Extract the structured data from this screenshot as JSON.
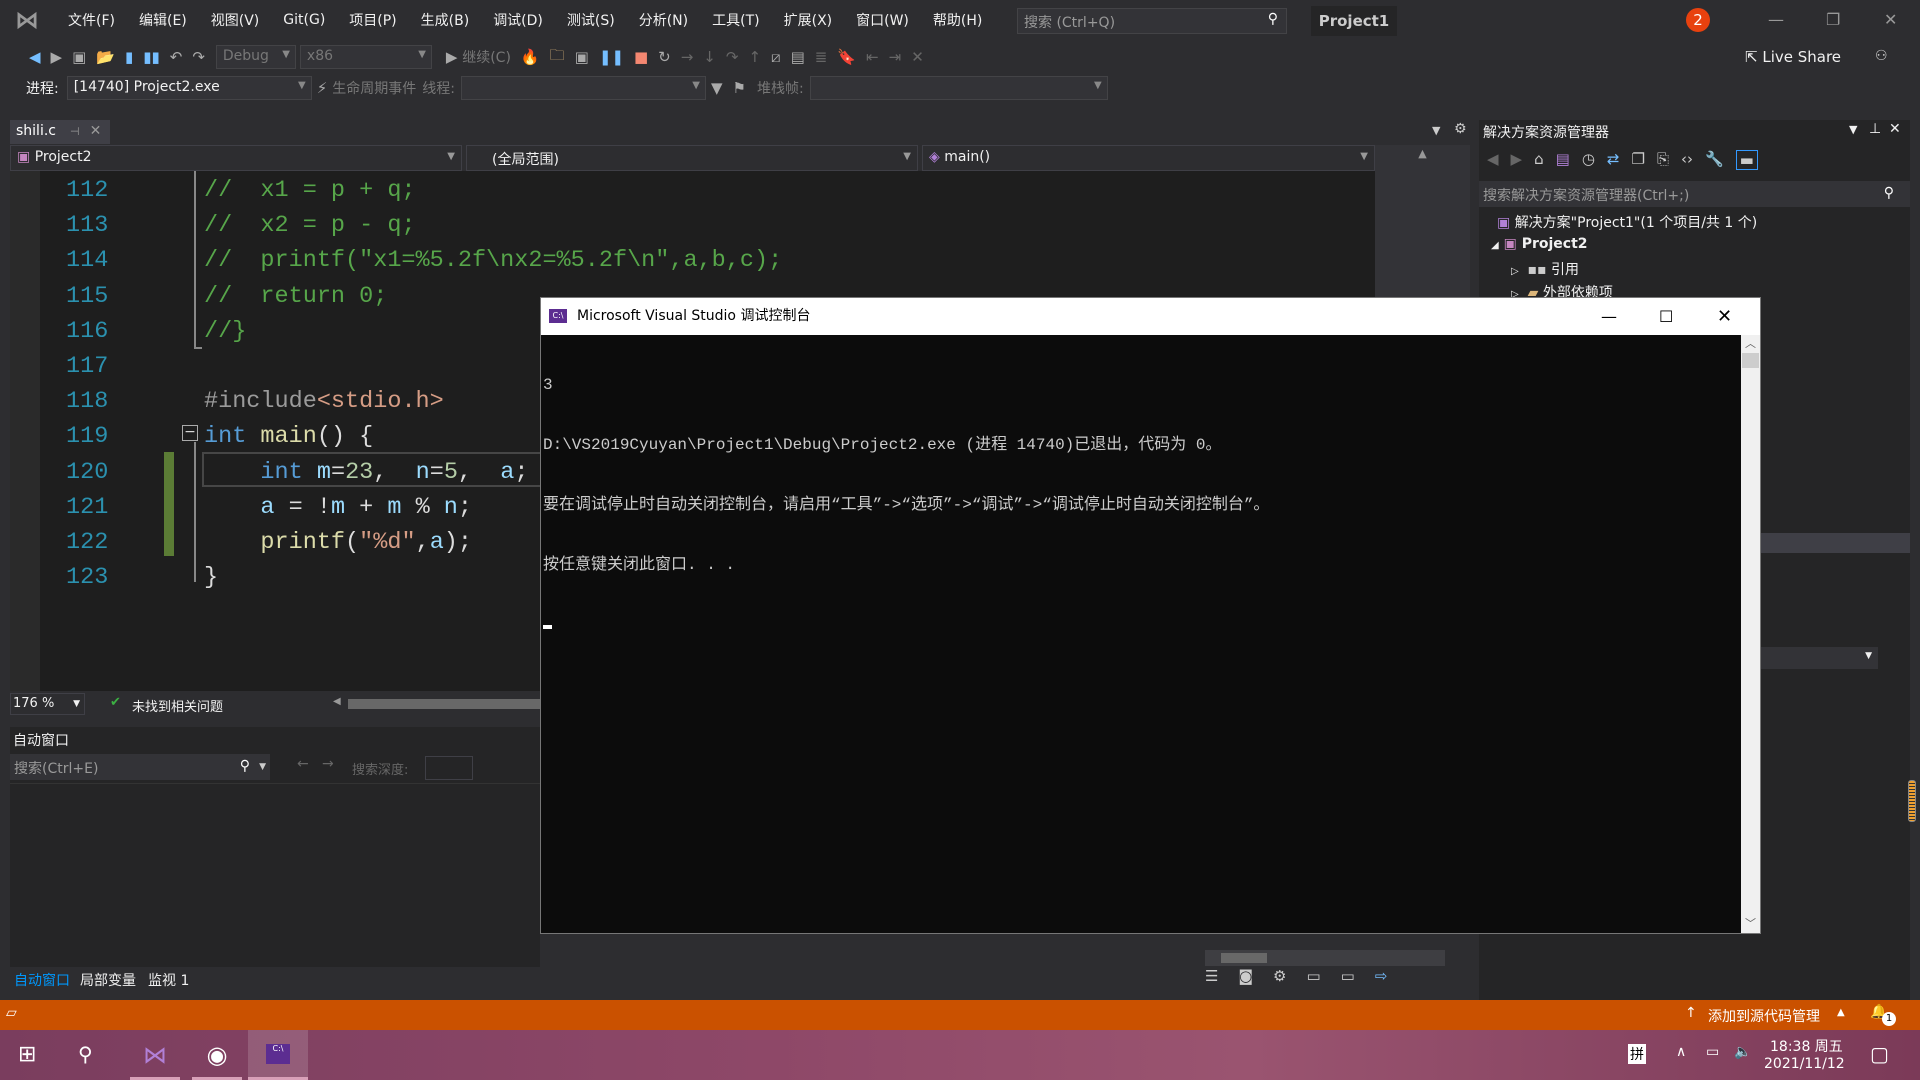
{
  "menubar": {
    "items": [
      "文件(F)",
      "编辑(E)",
      "视图(V)",
      "Git(G)",
      "项目(P)",
      "生成(B)",
      "调试(D)",
      "测试(S)",
      "分析(N)",
      "工具(T)",
      "扩展(X)",
      "窗口(W)",
      "帮助(H)"
    ],
    "search_placeholder": "搜索 (Ctrl+Q)",
    "project_name": "Project1",
    "notification_count": "2",
    "live_share": "Live Share"
  },
  "toolbar": {
    "configuration": "Debug",
    "platform": "x86",
    "continue": "继续(C)",
    "process_label": "进程:",
    "process_value": "[14740] Project2.exe",
    "lifecycle": "生命周期事件",
    "thread_label": "线程:",
    "stack_label": "堆栈帧:"
  },
  "editor": {
    "tab": "shili.c",
    "nav_project": "Project2",
    "nav_scope": "(全局范围)",
    "nav_function": "main()",
    "zoom": "176 %",
    "issues": "未找到相关问题",
    "lines": [
      {
        "num": "112",
        "tokens": [
          [
            "comment",
            "//  x1 = p + q;"
          ]
        ]
      },
      {
        "num": "113",
        "tokens": [
          [
            "comment",
            "//  x2 = p - q;"
          ]
        ]
      },
      {
        "num": "114",
        "tokens": [
          [
            "comment",
            "//  printf(\"x1=%5.2f\\nx2=%5.2f\\n\",a,b,c);"
          ]
        ]
      },
      {
        "num": "115",
        "tokens": [
          [
            "comment",
            "//  return 0;"
          ]
        ]
      },
      {
        "num": "116",
        "tokens": [
          [
            "comment",
            "//}"
          ]
        ]
      },
      {
        "num": "117",
        "tokens": []
      },
      {
        "num": "118",
        "tokens": [
          [
            "pp",
            "#include"
          ],
          [
            "str",
            "<stdio.h>"
          ]
        ]
      },
      {
        "num": "119",
        "tokens": [
          [
            "kw",
            "int"
          ],
          [
            "plain",
            " "
          ],
          [
            "fn",
            "main"
          ],
          [
            "plain",
            "() {"
          ]
        ]
      },
      {
        "num": "120",
        "tokens": [
          [
            "plain",
            "    "
          ],
          [
            "kw",
            "int"
          ],
          [
            "plain",
            " "
          ],
          [
            "var",
            "m"
          ],
          [
            "plain",
            "="
          ],
          [
            "num",
            "23"
          ],
          [
            "plain",
            ",  "
          ],
          [
            "var",
            "n"
          ],
          [
            "plain",
            "="
          ],
          [
            "num",
            "5"
          ],
          [
            "plain",
            ",  "
          ],
          [
            "var",
            "a"
          ],
          [
            "plain",
            ";"
          ]
        ]
      },
      {
        "num": "121",
        "tokens": [
          [
            "plain",
            "    "
          ],
          [
            "var",
            "a"
          ],
          [
            "plain",
            " = !"
          ],
          [
            "var",
            "m"
          ],
          [
            "plain",
            " + "
          ],
          [
            "var",
            "m"
          ],
          [
            "plain",
            " % "
          ],
          [
            "var",
            "n"
          ],
          [
            "plain",
            ";"
          ]
        ]
      },
      {
        "num": "122",
        "tokens": [
          [
            "plain",
            "    "
          ],
          [
            "fn",
            "printf"
          ],
          [
            "plain",
            "("
          ],
          [
            "str",
            "\"%d\""
          ],
          [
            "plain",
            ","
          ],
          [
            "var",
            "a"
          ],
          [
            "plain",
            ");"
          ]
        ]
      },
      {
        "num": "123",
        "tokens": [
          [
            "plain",
            "}"
          ]
        ]
      }
    ]
  },
  "autos": {
    "title": "自动窗口",
    "search_placeholder": "搜索(Ctrl+E)",
    "depth_label": "搜索深度:",
    "tabs": [
      "自动窗口",
      "局部变量",
      "监视 1"
    ]
  },
  "solution_explorer": {
    "title": "解决方案资源管理器",
    "search_placeholder": "搜索解决方案资源管理器(Ctrl+;)",
    "tree": [
      "解决方案\"Project1\"(1 个项目/共 1 个)",
      "Project2",
      "引用",
      "外部依赖项"
    ]
  },
  "console": {
    "title": "Microsoft Visual Studio 调试控制台",
    "lines": [
      "3",
      "D:\\VS2019Cyuyan\\Project1\\Debug\\Project2.exe (进程 14740)已退出，代码为 0。",
      "要在调试停止时自动关闭控制台，请启用“工具”->“选项”->“调试”->“调试停止时自动关闭控制台”。",
      "按任意键关闭此窗口. . ."
    ]
  },
  "statusbar": {
    "source_control": "添加到源代码管理",
    "notifications": "1"
  },
  "taskbar": {
    "ime": "拼",
    "time": "18:38 周五",
    "date": "2021/11/12"
  }
}
